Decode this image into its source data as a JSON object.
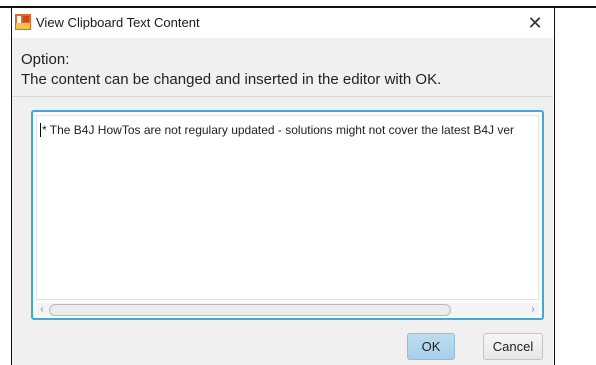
{
  "window": {
    "title": "View Clipboard Text Content",
    "close_glyph": "✕"
  },
  "header": {
    "option_label": "Option:",
    "description": "The content can be changed and inserted in the editor with OK."
  },
  "editor": {
    "text": "* The B4J HowTos are not regulary updated - solutions might not cover the latest B4J ver"
  },
  "scrollbar": {
    "left_arrow": "‹",
    "right_arrow": "›"
  },
  "buttons": {
    "ok_label": "OK",
    "cancel_label": "Cancel"
  },
  "colors": {
    "focus_border": "#3fa9d8",
    "ok_button": "#b3d7ee"
  },
  "icons": {
    "app": "b4j-app-icon",
    "close": "close-icon"
  }
}
